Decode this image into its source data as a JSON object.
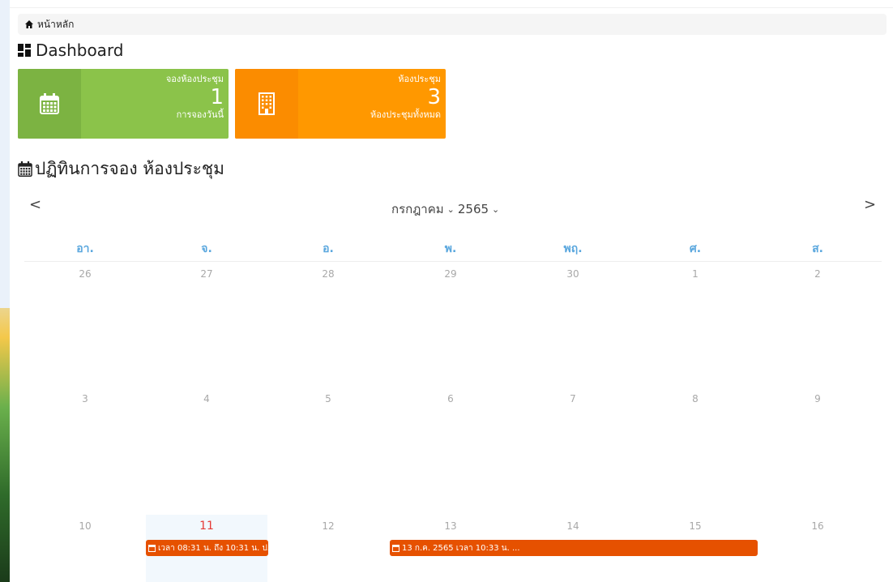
{
  "breadcrumb": {
    "home_label": "หน้าหลัก"
  },
  "page": {
    "title": "Dashboard"
  },
  "cards": [
    {
      "label": "จองห้องประชุม",
      "value": "1",
      "sub": "การจองวันนี้",
      "color": "#8bc34a"
    },
    {
      "label": "ห้องประชุม",
      "value": "3",
      "sub": "ห้องประชุมทั้งหมด",
      "color": "#ff9800"
    }
  ],
  "calendar": {
    "title": "ปฏิทินการจอง ห้องประชุม",
    "prev": "<",
    "next": ">",
    "month": "กรกฎาคม",
    "year": "2565",
    "weekdays": [
      "อา.",
      "จ.",
      "อ.",
      "พ.",
      "พฤ.",
      "ศ.",
      "ส."
    ],
    "weeks": [
      [
        "26",
        "27",
        "28",
        "29",
        "30",
        "1",
        "2"
      ],
      [
        "3",
        "4",
        "5",
        "6",
        "7",
        "8",
        "9"
      ],
      [
        "10",
        "11",
        "12",
        "13",
        "14",
        "15",
        "16"
      ]
    ],
    "today": "11",
    "events": [
      {
        "text": "เวลา 08:31 น. ถึง 10:31 น. ป...",
        "color": "#e65100"
      },
      {
        "text": "13 ก.ค. 2565 เวลา 10:33 น. ...",
        "color": "#e65100"
      }
    ]
  }
}
